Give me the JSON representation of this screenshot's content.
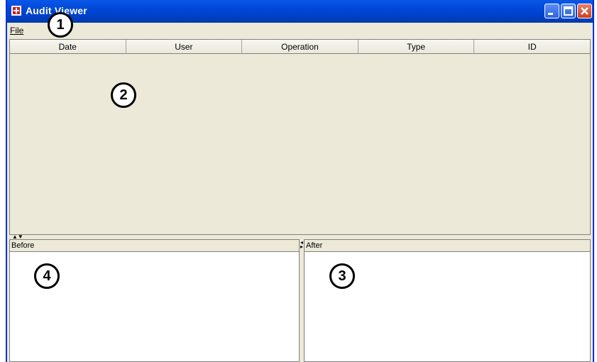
{
  "window": {
    "title": "Audit Viewer"
  },
  "menu": {
    "items": [
      {
        "label": "File"
      }
    ]
  },
  "table": {
    "columns": [
      "Date",
      "User",
      "Operation",
      "Type",
      "ID"
    ]
  },
  "panels": {
    "before": "Before",
    "after": "After"
  },
  "annotations": [
    "1",
    "2",
    "3",
    "4"
  ]
}
